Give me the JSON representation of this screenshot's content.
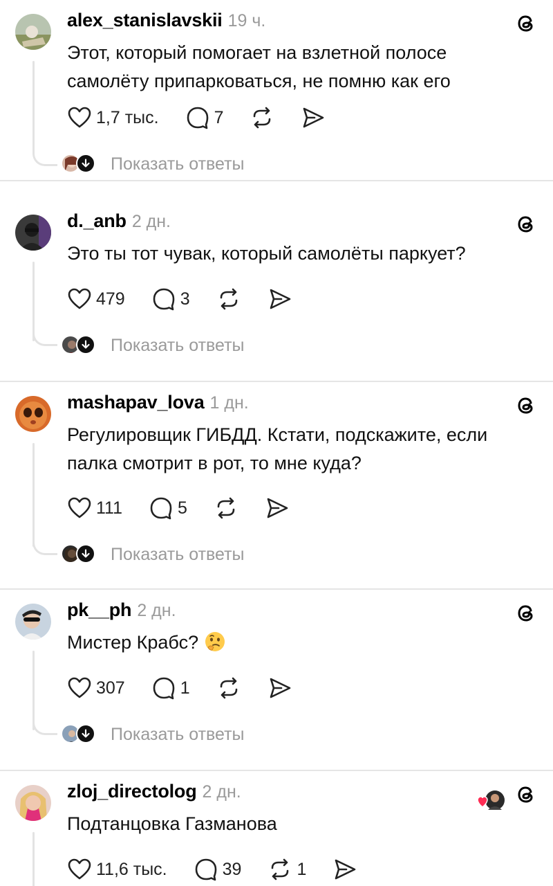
{
  "posts": [
    {
      "username": "alex_stanislavskii",
      "time": "19 ч.",
      "text_lines": [
        "Этот, который помогает на взлетной полосе",
        "самолёту припарковаться, не помню как его"
      ],
      "likes": "1,7 тыс.",
      "comments": "7",
      "reposts": "",
      "show_replies": "Показать ответы"
    },
    {
      "username": "d._anb",
      "time": "2 дн.",
      "text_lines": [
        "Это ты тот чувак, который самолёты паркует?"
      ],
      "likes": "479",
      "comments": "3",
      "reposts": "",
      "show_replies": "Показать ответы"
    },
    {
      "username": "mashapav_lova",
      "time": "1 дн.",
      "text_lines": [
        "Регулировщик ГИБДД. Кстати, подскажите, если",
        "палка смотрит в рот, то мне куда?"
      ],
      "likes": "111",
      "comments": "5",
      "reposts": "",
      "show_replies": "Показать ответы"
    },
    {
      "username": "pk__ph",
      "time": "2 дн.",
      "text_lines": [
        "Мистер Крабс?"
      ],
      "emoji": "thinking-face",
      "likes": "307",
      "comments": "1",
      "reposts": "",
      "show_replies": "Показать ответы"
    },
    {
      "username": "zloj_directolog",
      "time": "2 дн.",
      "text_lines": [
        "Подтанцовка Газманова"
      ],
      "likes": "11,6 тыс.",
      "comments": "39",
      "reposts": "1",
      "liked_by_author": true
    }
  ],
  "icons": {
    "like": "heart-icon",
    "comment": "comment-icon",
    "repost": "repost-icon",
    "share": "share-icon",
    "brand": "threads-icon"
  },
  "colors": {
    "text": "#111111",
    "muted": "#9a9a9a",
    "divider": "#e5e5e5",
    "liked_heart": "#ff2d55"
  }
}
